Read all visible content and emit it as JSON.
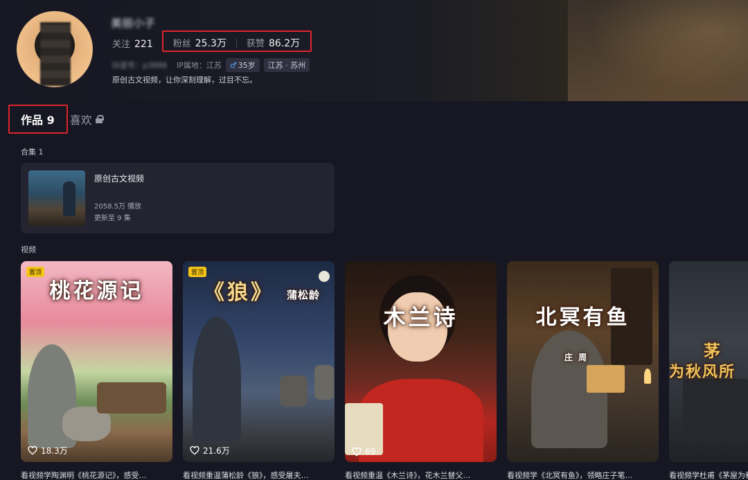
{
  "profile": {
    "username": "美丽小子",
    "following_label": "关注",
    "following_count": "221",
    "followers_label": "粉丝",
    "followers_count": "25.3万",
    "likes_label": "获赞",
    "likes_count": "86.2万",
    "douyin_id": "抖音号：p3888",
    "ip_location": "IP属地：江苏",
    "age_tag": "35岁",
    "location_tag": "江苏 · 苏州",
    "bio": "原创古文视频，让你深刻理解，过目不忘。"
  },
  "tabs": {
    "works_label": "作品 9",
    "likes_label": "喜欢"
  },
  "collections": {
    "section_label": "合集 1",
    "items": [
      {
        "title": "原创古文视频",
        "plays": "2058.5万 播放",
        "update": "更新至 9 集"
      }
    ]
  },
  "videos": {
    "section_label": "视频",
    "items": [
      {
        "cover_title": "桃花源记",
        "pinned": true,
        "pin_label": "置顶",
        "likes": "18.3万",
        "caption": "看视频学陶渊明《桃花源记》，感受…"
      },
      {
        "cover_title": "《狼》",
        "cover_subtitle": "蒲松龄",
        "pinned": true,
        "pin_label": "置顶",
        "likes": "21.6万",
        "caption": "看视频重温蒲松龄《狼》，感受屠夫…"
      },
      {
        "cover_title": "木兰诗",
        "pinned": false,
        "likes": "69",
        "caption": "看视频重温《木兰诗》，花木兰替父…"
      },
      {
        "cover_title": "北冥有鱼",
        "cover_subtitle": "庄 周",
        "pinned": false,
        "likes": "",
        "caption": "看视频学《北冥有鱼》，领略庄子笔…"
      },
      {
        "cover_title": "茅屋为秋风所破歌",
        "cover_visible": "茅",
        "cover_visible_2": "为秋风所",
        "pinned": false,
        "likes": "",
        "caption": "看视频学杜甫《茅屋为秋风所破歌》"
      }
    ]
  },
  "colors": {
    "highlight_box": "#e0242b",
    "pin_badge": "#f5c518",
    "background": "#161722",
    "card_background": "#23242f"
  }
}
